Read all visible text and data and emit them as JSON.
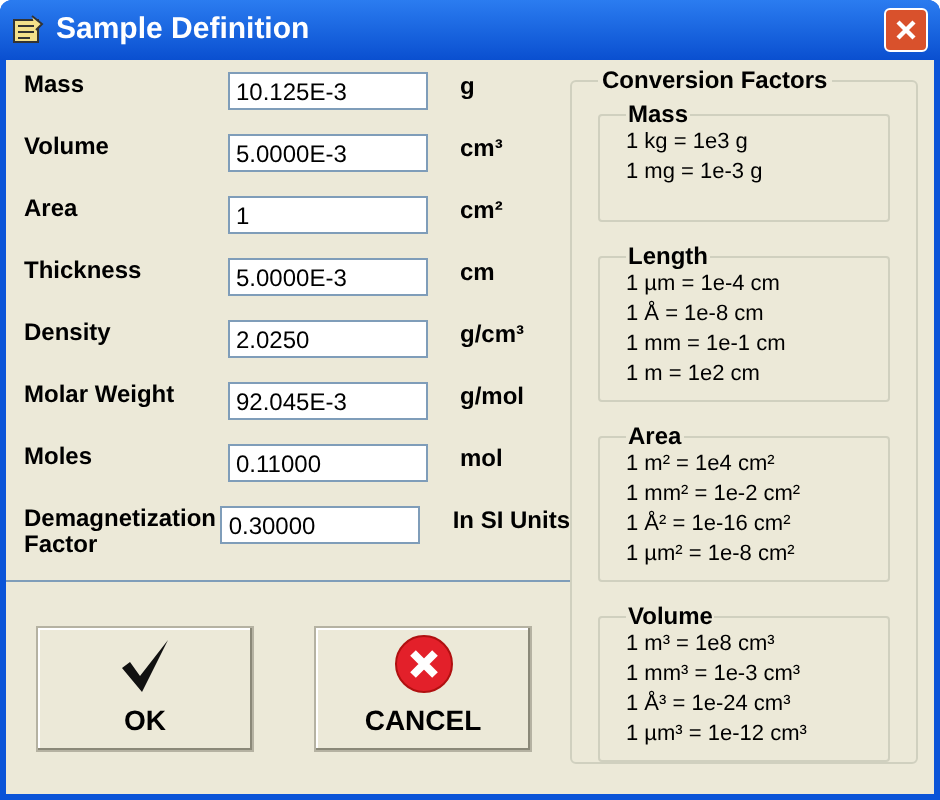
{
  "window": {
    "title": "Sample Definition"
  },
  "fields": [
    {
      "label": "Mass",
      "value": "10.125E-3",
      "unit": "g"
    },
    {
      "label": "Volume",
      "value": "5.0000E-3",
      "unit": "cm³"
    },
    {
      "label": "Area",
      "value": "1",
      "unit": "cm²"
    },
    {
      "label": "Thickness",
      "value": "5.0000E-3",
      "unit": "cm"
    },
    {
      "label": "Density",
      "value": "2.0250",
      "unit": "g/cm³"
    },
    {
      "label": "Molar Weight",
      "value": "92.045E-3",
      "unit": "g/mol"
    },
    {
      "label": "Moles",
      "value": "0.11000",
      "unit": "mol"
    },
    {
      "label": "Demagnetization Factor",
      "value": "0.30000",
      "unit": "In SI Units"
    }
  ],
  "conversion_factors": {
    "title": "Conversion Factors",
    "groups": [
      {
        "title": "Mass",
        "lines": [
          "1 kg = 1e3 g",
          "1 mg = 1e-3 g"
        ]
      },
      {
        "title": "Length",
        "lines": [
          "1 µm = 1e-4 cm",
          "1 Å = 1e-8 cm",
          "1 mm = 1e-1 cm",
          "1 m = 1e2 cm"
        ]
      },
      {
        "title": "Area",
        "lines": [
          "1 m² = 1e4 cm²",
          "1 mm² = 1e-2 cm²",
          "1 Å² = 1e-16 cm²",
          "1 µm² = 1e-8 cm²"
        ]
      },
      {
        "title": "Volume",
        "lines": [
          "1 m³ = 1e8 cm³",
          "1 mm³ = 1e-3 cm³",
          "1 Å³ = 1e-24 cm³",
          "1 µm³ = 1e-12 cm³"
        ]
      }
    ]
  },
  "buttons": [
    {
      "kind": "ok",
      "label": "OK"
    },
    {
      "kind": "cancel",
      "label": "CANCEL"
    }
  ]
}
